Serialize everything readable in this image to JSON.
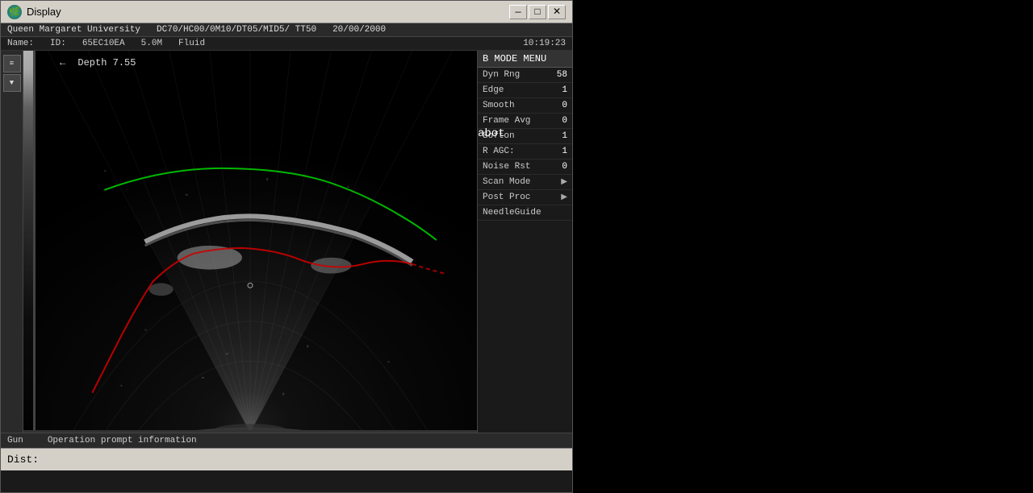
{
  "window": {
    "title": "Display",
    "title_icon": "🌿",
    "controls": {
      "minimize": "—",
      "maximize": "□",
      "close": "✕"
    }
  },
  "header": {
    "institution": "Queen Margaret University",
    "scan_params": "DC70/HC00/0M10/DT05/MID5/ TT50",
    "date": "20/00/2000",
    "name_label": "Name:",
    "name_value": "",
    "id_label": "ID:",
    "id_value": "65EC10EA",
    "size": "5.0M",
    "mode": "Fluid",
    "time": "10:19:23"
  },
  "ultrasound": {
    "back_arrow": "←",
    "depth_label": "Depth 7.55"
  },
  "bmode_menu": {
    "title": "B MODE MENU",
    "items": [
      {
        "label": "Dyn Rng",
        "value": "58",
        "has_arrow": false
      },
      {
        "label": "Edge",
        "value": "1",
        "has_arrow": false
      },
      {
        "label": "Smooth",
        "value": "0",
        "has_arrow": false
      },
      {
        "label": "Frame Avg",
        "value": "0",
        "has_arrow": false
      },
      {
        "label": "Softon",
        "value": "1",
        "has_arrow": false
      },
      {
        "label": "R AGC:",
        "value": "1",
        "has_arrow": false
      },
      {
        "label": "Noise Rst",
        "value": "0",
        "has_arrow": false
      },
      {
        "label": "Scan Mode",
        "value": "",
        "has_arrow": true
      },
      {
        "label": "Post Proc",
        "value": "",
        "has_arrow": true
      },
      {
        "label": "NeedleGuide",
        "value": "",
        "has_arrow": false
      }
    ]
  },
  "status_bar": {
    "gun_label": "Gun",
    "operation_label": "Operation prompt information"
  },
  "dist_bar": {
    "label": "Dist:"
  },
  "abot": {
    "text": "abot"
  }
}
